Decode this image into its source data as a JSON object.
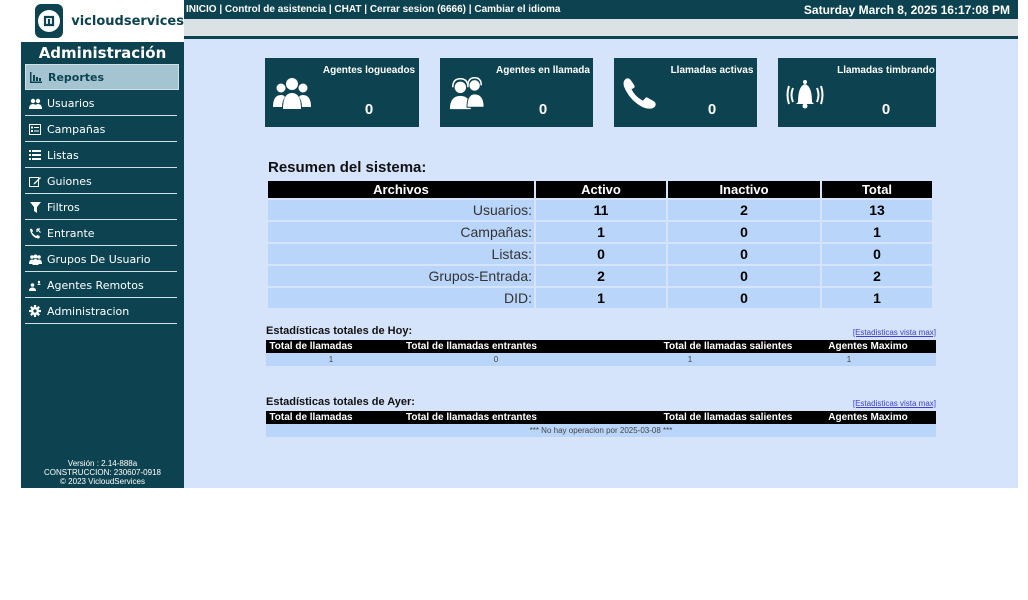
{
  "brand": {
    "name": "vicloudservices"
  },
  "sidebar": {
    "title": "Administración",
    "items": [
      {
        "label": "Reportes",
        "icon": "bar-chart-icon"
      },
      {
        "label": "Usuarios",
        "icon": "users-icon"
      },
      {
        "label": "Campañas",
        "icon": "campaign-icon"
      },
      {
        "label": "Listas",
        "icon": "list-icon"
      },
      {
        "label": "Guiones",
        "icon": "edit-icon"
      },
      {
        "label": "Filtros",
        "icon": "filter-icon"
      },
      {
        "label": "Entrante",
        "icon": "inbound-call-icon"
      },
      {
        "label": "Grupos De Usuario",
        "icon": "user-groups-icon"
      },
      {
        "label": "Agentes Remotos",
        "icon": "remote-agents-icon"
      },
      {
        "label": "Administracion",
        "icon": "gear-icon"
      }
    ],
    "version_line1": "Versión : 2.14-888a",
    "version_line2": "CONSTRUCCION: 230607-0918",
    "version_line3": "© 2023 VicloudServices"
  },
  "topbar": {
    "links": [
      "INICIO",
      "Control de asistencia",
      "CHAT",
      "Cerrar sesion (6666)",
      "Cambiar el idioma"
    ],
    "separator": " | ",
    "clock": "Saturday March 8, 2025 16:17:08 PM"
  },
  "cards": [
    {
      "label": "Agentes logueados",
      "value": "0",
      "icon": "users-group-icon"
    },
    {
      "label": "Agentes en llamada",
      "value": "0",
      "icon": "headset-agents-icon"
    },
    {
      "label": "Llamadas activas",
      "value": "0",
      "icon": "phone-icon"
    },
    {
      "label": "Llamadas timbrando",
      "value": "0",
      "icon": "ringing-bell-icon"
    }
  ],
  "resumen": {
    "title": "Resumen del sistema:",
    "headers": [
      "Archivos",
      "Activo",
      "Inactivo",
      "Total"
    ],
    "rows": [
      {
        "name": "Usuarios:",
        "activo": "11",
        "inactivo": "2",
        "total": "13"
      },
      {
        "name": "Campañas:",
        "activo": "1",
        "inactivo": "0",
        "total": "1"
      },
      {
        "name": "Listas:",
        "activo": "0",
        "inactivo": "0",
        "total": "0"
      },
      {
        "name": "Grupos-Entrada:",
        "activo": "2",
        "inactivo": "0",
        "total": "2"
      },
      {
        "name": "DID:",
        "activo": "1",
        "inactivo": "0",
        "total": "1"
      }
    ]
  },
  "hoy": {
    "title": "Estadísticas totales de Hoy:",
    "link": "[Estadisticas vista max]",
    "headers": [
      "Total de llamadas",
      "Total de llamadas entrantes",
      "Total de llamadas salientes",
      "Agentes Maximo"
    ],
    "values": [
      "1",
      "0",
      "1",
      "1"
    ]
  },
  "ayer": {
    "title": "Estadísticas totales de Ayer:",
    "link": "[Estadisticas vista max]",
    "headers": [
      "Total de llamadas",
      "Total de llamadas entrantes",
      "Total de llamadas salientes",
      "Agentes Maximo"
    ],
    "message": "*** No hay operacion por 2025-03-08 ***"
  },
  "colors": {
    "primary": "#0d4350",
    "main_bg": "#d6e4fb",
    "cell_bg": "#b9d5f9",
    "active_nav": "#a5c4d1"
  }
}
